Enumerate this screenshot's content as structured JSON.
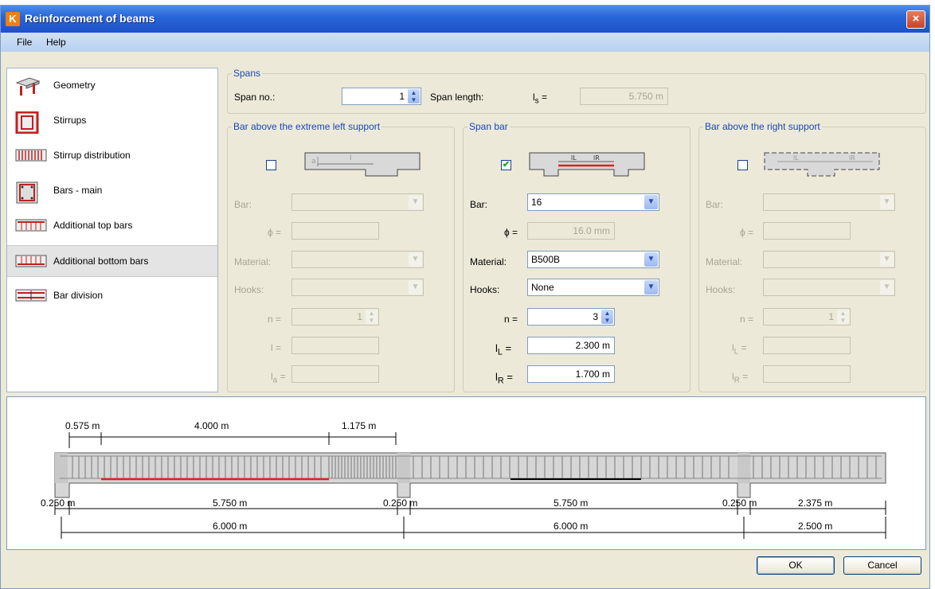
{
  "window": {
    "title": "Reinforcement of beams",
    "app_icon": "app-logo-icon",
    "close_label": "×"
  },
  "menu": [
    "File",
    "Help"
  ],
  "nav": {
    "items": [
      {
        "label": "Geometry",
        "icon": "geometry-icon"
      },
      {
        "label": "Stirrups",
        "icon": "stirrups-icon"
      },
      {
        "label": "Stirrup distribution",
        "icon": "stirrup-distribution-icon"
      },
      {
        "label": "Bars - main",
        "icon": "bars-main-icon"
      },
      {
        "label": "Additional top bars",
        "icon": "additional-top-bars-icon"
      },
      {
        "label": "Additional bottom bars",
        "icon": "additional-bottom-bars-icon"
      },
      {
        "label": "Bar division",
        "icon": "bar-division-icon"
      }
    ],
    "selected": "Additional bottom bars"
  },
  "spans": {
    "legend": "Spans",
    "span_no_label": "Span no.:",
    "span_no": "1",
    "span_length_label": "Span length:",
    "ls_symbol": "l",
    "ls_sub": "s",
    "ls_eq": "=",
    "span_length": "5.750 m"
  },
  "left_group": {
    "legend": "Bar above the extreme left support",
    "checked": false,
    "bar_label": "Bar:",
    "phi_label": "ϕ =",
    "material_label": "Material:",
    "hooks_label": "Hooks:",
    "n_label": "n =",
    "n": "1",
    "l_label": "l =",
    "la_label": "l",
    "la_sub": "a",
    "la_eq": "=",
    "diagram_left_text": "a",
    "diagram_top_text": "l"
  },
  "span_group": {
    "legend": "Span bar",
    "checked": true,
    "check_mark": "✔",
    "bar_label": "Bar:",
    "bar": "16",
    "phi_label": "ϕ =",
    "phi": "16.0 mm",
    "material_label": "Material:",
    "material": "B500B",
    "hooks_label": "Hooks:",
    "hooks": "None",
    "n_label": "n =",
    "n": "3",
    "lL_label": "l",
    "lL_sub": "L",
    "lL_eq": "=",
    "lL": "2.300 m",
    "lR_label": "l",
    "lR_sub": "R",
    "lR_eq": "=",
    "lR": "1.700 m",
    "diagram_l_text": "lL",
    "diagram_r_text": "lR"
  },
  "right_group": {
    "legend": "Bar above the right support",
    "checked": false,
    "bar_label": "Bar:",
    "phi_label": "ϕ =",
    "material_label": "Material:",
    "hooks_label": "Hooks:",
    "n_label": "n =",
    "n": "1",
    "lL_label": "l",
    "lL_sub": "L",
    "lL_eq": "=",
    "lR_label": "l",
    "lR_sub": "R",
    "lR_eq": "=",
    "diagram_l_text": "lL",
    "diagram_r_text": "lR"
  },
  "preview": {
    "top_dims": [
      "0.575 m",
      "4.000 m",
      "1.175 m"
    ],
    "support_widths": [
      "0.250 m",
      "0.250 m",
      "0.250 m"
    ],
    "clear_spans": [
      "5.750 m",
      "5.750 m",
      "2.375 m"
    ],
    "total_spans": [
      "6.000 m",
      "6.000 m",
      "2.500 m"
    ],
    "colors": {
      "beam": "#d6d6d6",
      "bar_active": "#e02020",
      "bar_other": "#000000"
    }
  },
  "buttons": {
    "ok": "OK",
    "cancel": "Cancel"
  }
}
